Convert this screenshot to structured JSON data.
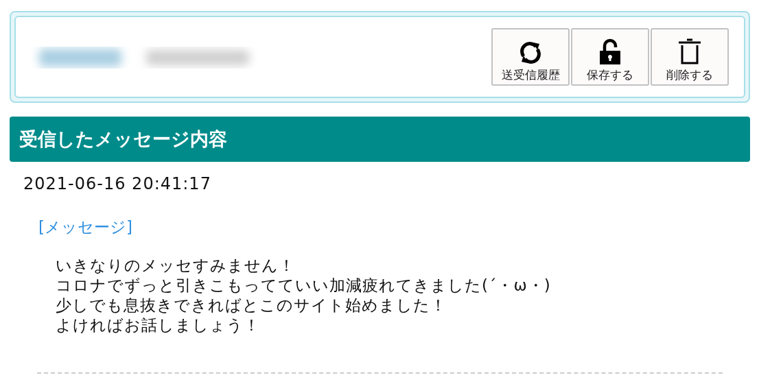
{
  "header": {
    "buttons": [
      {
        "kind": "history",
        "label": "送受信履歴"
      },
      {
        "kind": "save",
        "label": "保存する"
      },
      {
        "kind": "delete",
        "label": "削除する"
      }
    ]
  },
  "section": {
    "title": "受信したメッセージ内容"
  },
  "message": {
    "datetime": "2021-06-16 20:41:17",
    "label": "[メッセージ]",
    "lines": [
      "いきなりのメッセすみません！",
      "コロナでずっと引きこもってていい加減疲れてきました(´・ω・)",
      "少しでも息抜きできればとこのサイト始めました！",
      "よければお話しましょう！"
    ]
  }
}
